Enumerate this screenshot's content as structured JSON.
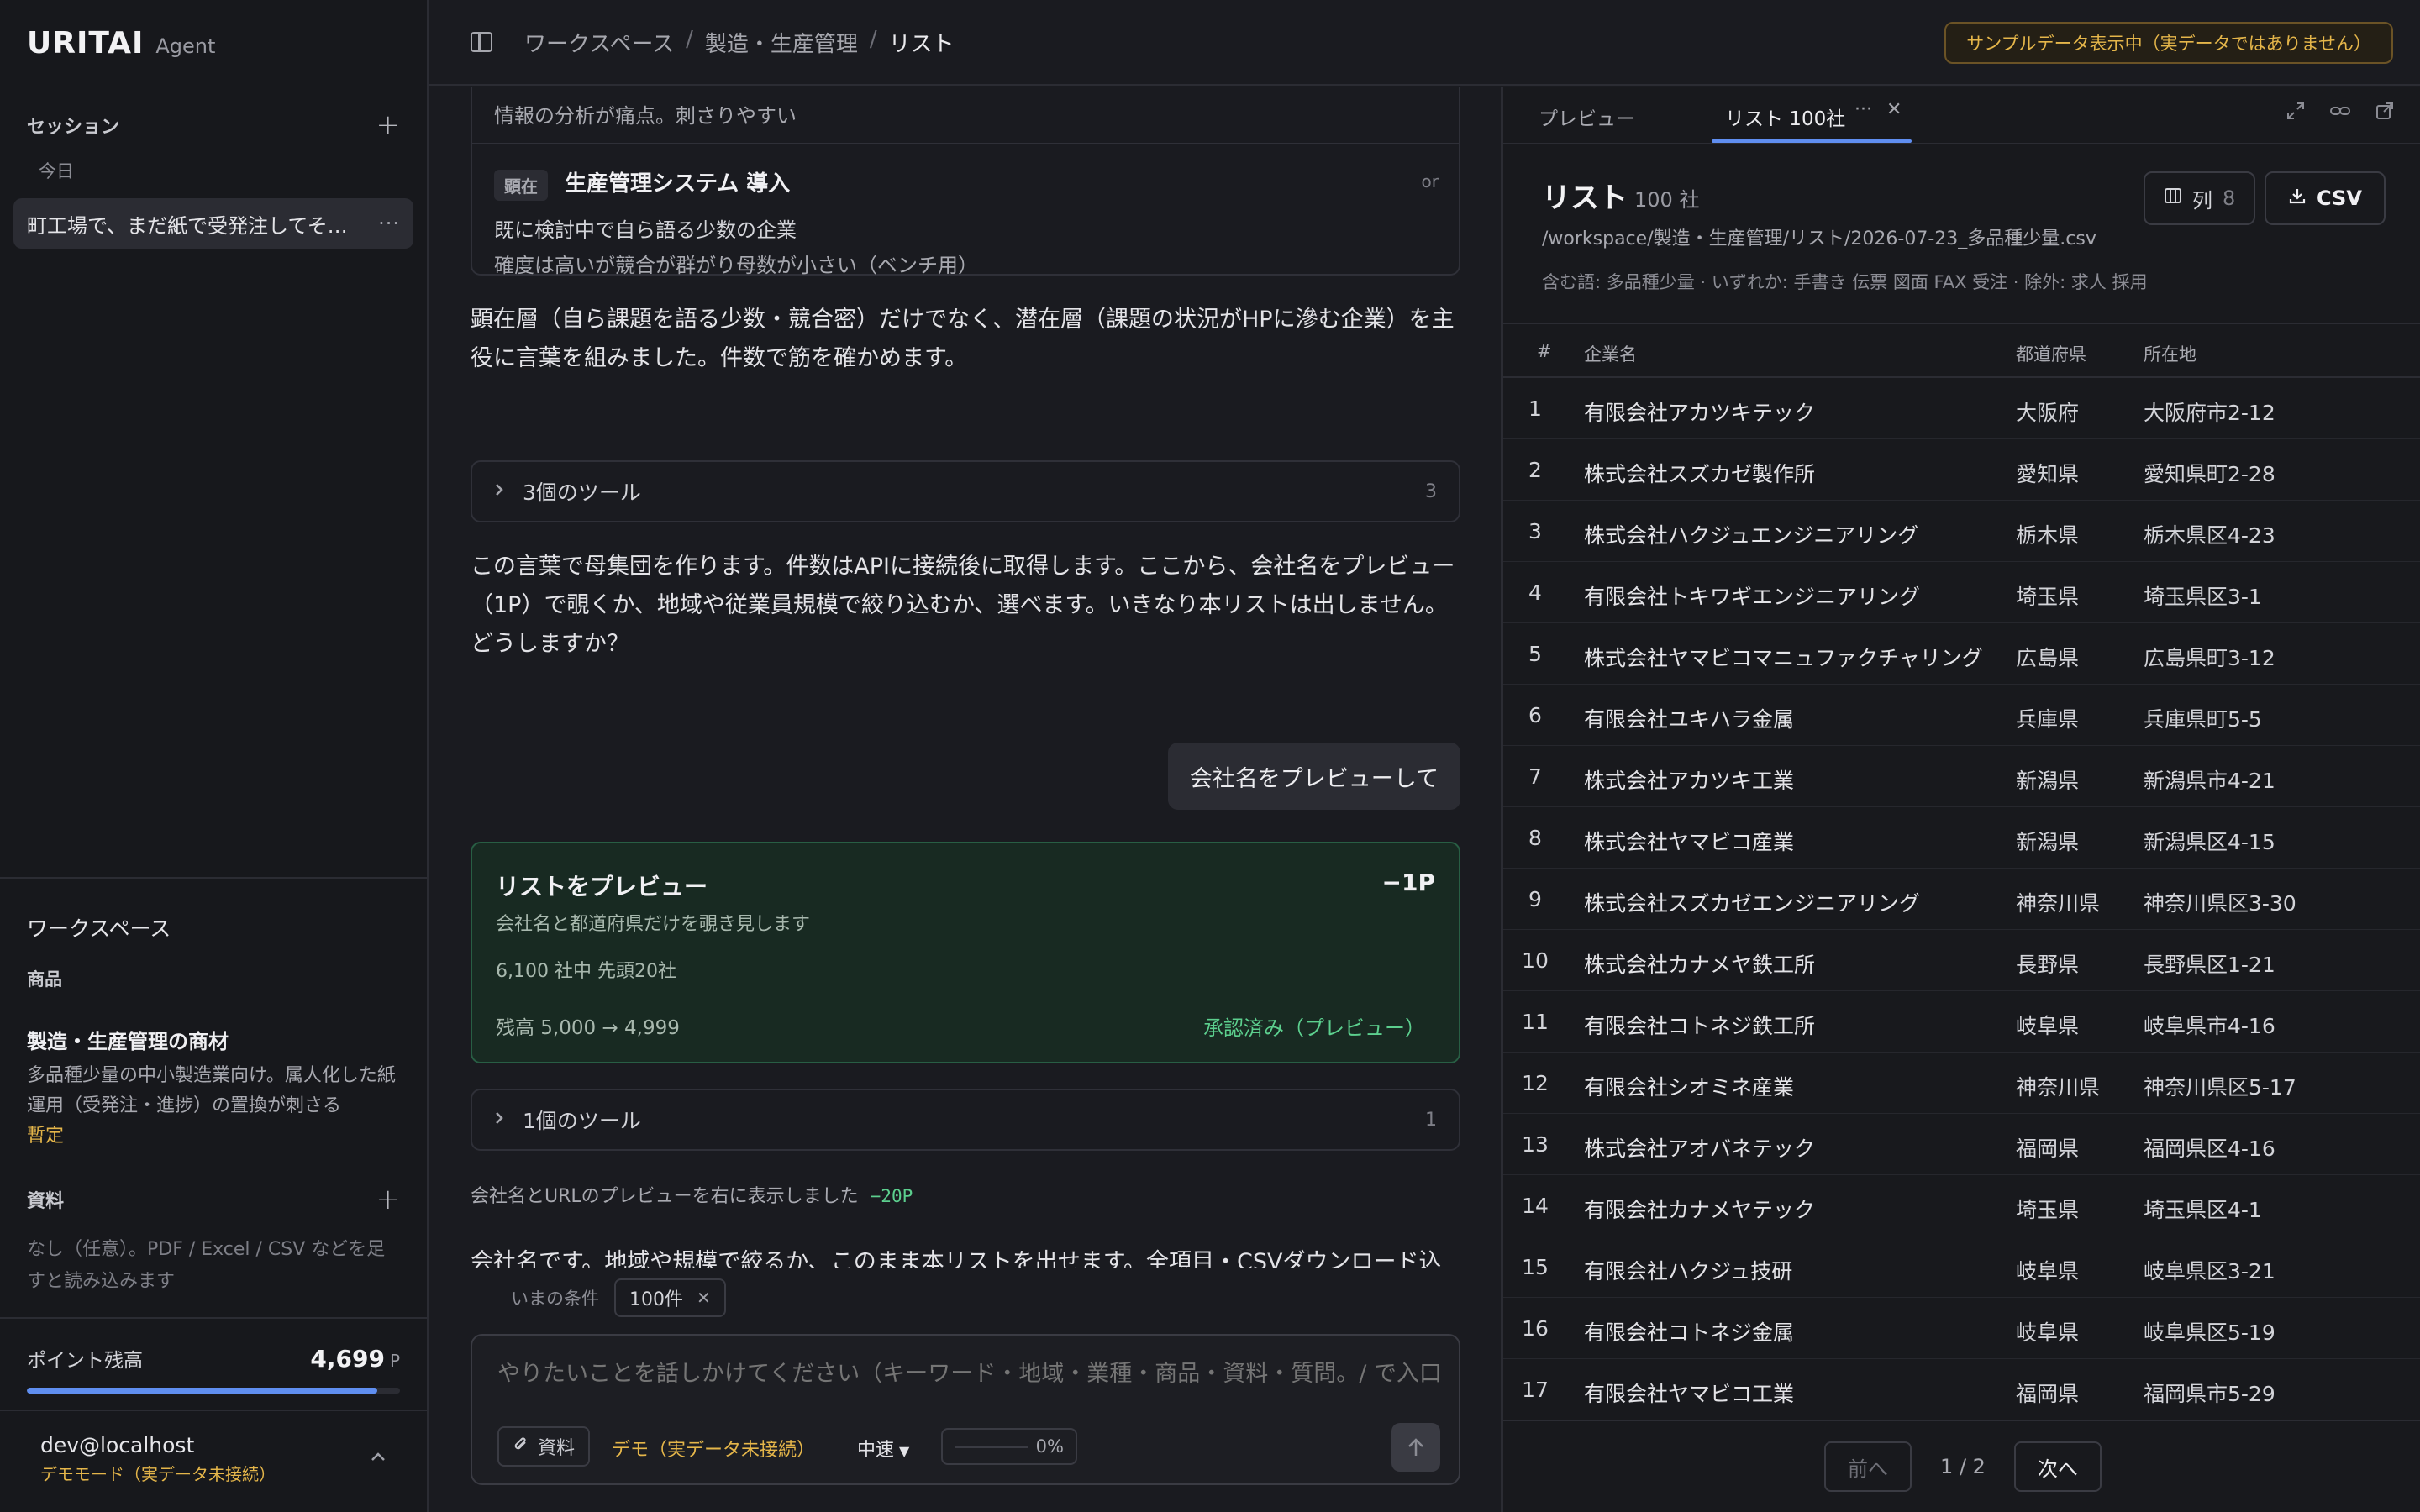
{
  "app": {
    "brand": "URITAI",
    "brand_sub": "Agent"
  },
  "sidebar": {
    "sessions_label": "セッション",
    "today_label": "今日",
    "session_item": "町工場で、まだ紙で受発注してそ…",
    "workspace_title": "ワークスペース",
    "product_label": "商品",
    "product_name": "製造・生産管理の商材",
    "product_desc": "多品種少量の中小製造業向け。属人化した紙運用（受発注・進捗）の置換が刺さる",
    "product_badge": "暫定",
    "materials_label": "資料",
    "materials_desc": "なし（任意）。PDF / Excel / CSV などを足すと読み込みます",
    "points_label": "ポイント残高",
    "points_value": "4,699",
    "points_unit": "P",
    "points_fraction": 0.9398,
    "user_name": "dev@localhost",
    "user_mode": "デモモード（実データ未接続）"
  },
  "topbar": {
    "crumbs": [
      "ワークスペース",
      "製造・生産管理",
      "リスト"
    ],
    "separator": "/",
    "sample_badge": "サンプルデータ表示中（実データではありません）"
  },
  "chat": {
    "card_text1": "情報の分析が痛点。刺さりやすい",
    "card_tag": "顕在",
    "card_title": "生産管理システム 導入",
    "card_or": "or",
    "card_line1": "既に検討中で自ら語る少数の企業",
    "card_line2": "確度は高いが競合が群がり母数が小さい（ベンチ用）",
    "para1": "顕在層（自ら課題を語る少数・競合密）だけでなく、潜在層（課題の状況がHPに滲む企業）を主役に言葉を組みました。件数で筋を確かめます。",
    "tool1_label": "3個のツール",
    "tool1_count": "3",
    "para2": "この言葉で母集団を作ります。件数はAPIに接続後に取得します。ここから、会社名をプレビュー（1P）で覗くか、地域や従業員規模で絞り込むか、選べます。いきなり本リストは出しません。どうしますか？",
    "user_msg": "会社名をプレビューして",
    "preview_title": "リストをプレビュー",
    "preview_cost": "−1P",
    "preview_sub": "会社名と都道府県だけを覗き見します",
    "preview_count": "6,100 社中 先頭20社",
    "preview_balance": "残高 5,000 → 4,999",
    "preview_status": "承認済み（プレビュー）",
    "tool2_label": "1個のツール",
    "tool2_count": "1",
    "preview_note": "会社名とURLのプレビューを右に表示しました",
    "preview_note_cost": "−20P",
    "cut_line": "会社名です。地域や規模で絞るか、このまま本リストを出せます。全項目・CSVダウンロード込",
    "cond_label": "いまの条件",
    "cond_chip": "100件",
    "composer_placeholder": "やりたいことを話しかけてください（キーワード・地域・業種・商品・資料・質問。/ で入口",
    "attach_label": "資料",
    "demo_note": "デモ（実データ未接続）",
    "speed_label": "中速",
    "progress_value": "0%",
    "progress_fraction": 0
  },
  "panel": {
    "tab_preview": "プレビュー",
    "tab_list": "リスト 100社",
    "list_title": "リスト",
    "list_count": "100 社",
    "list_path": "/workspace/製造・生産管理/リスト/2026-07-23_多品種少量.csv",
    "list_filter": "含む語: 多品種少量 · いずれか: 手書き 伝票 図面 FAX 受注 · 除外: 求人 採用",
    "col_label": "列",
    "col_count": "8",
    "csv_label": "CSV",
    "headers": {
      "num": "#",
      "company": "企業名",
      "pref": "都道府県",
      "addr": "所在地"
    },
    "rows": [
      {
        "num": "1",
        "company": "有限会社アカツキテック",
        "pref": "大阪府",
        "addr": "大阪府市2-12"
      },
      {
        "num": "2",
        "company": "株式会社スズカゼ製作所",
        "pref": "愛知県",
        "addr": "愛知県町2-28"
      },
      {
        "num": "3",
        "company": "株式会社ハクジュエンジニアリング",
        "pref": "栃木県",
        "addr": "栃木県区4-23"
      },
      {
        "num": "4",
        "company": "有限会社トキワギエンジニアリング",
        "pref": "埼玉県",
        "addr": "埼玉県区3-1"
      },
      {
        "num": "5",
        "company": "株式会社ヤマビコマニュファクチャリング",
        "pref": "広島県",
        "addr": "広島県町3-12"
      },
      {
        "num": "6",
        "company": "有限会社ユキハラ金属",
        "pref": "兵庫県",
        "addr": "兵庫県町5-5"
      },
      {
        "num": "7",
        "company": "株式会社アカツキ工業",
        "pref": "新潟県",
        "addr": "新潟県市4-21"
      },
      {
        "num": "8",
        "company": "株式会社ヤマビコ産業",
        "pref": "新潟県",
        "addr": "新潟県区4-15"
      },
      {
        "num": "9",
        "company": "株式会社スズカゼエンジニアリング",
        "pref": "神奈川県",
        "addr": "神奈川県区3-30"
      },
      {
        "num": "10",
        "company": "株式会社カナメヤ鉄工所",
        "pref": "長野県",
        "addr": "長野県区1-21"
      },
      {
        "num": "11",
        "company": "有限会社コトネジ鉄工所",
        "pref": "岐阜県",
        "addr": "岐阜県市4-16"
      },
      {
        "num": "12",
        "company": "有限会社シオミネ産業",
        "pref": "神奈川県",
        "addr": "神奈川県区5-17"
      },
      {
        "num": "13",
        "company": "株式会社アオバネテック",
        "pref": "福岡県",
        "addr": "福岡県区4-16"
      },
      {
        "num": "14",
        "company": "有限会社カナメヤテック",
        "pref": "埼玉県",
        "addr": "埼玉県区4-1"
      },
      {
        "num": "15",
        "company": "有限会社ハクジュ技研",
        "pref": "岐阜県",
        "addr": "岐阜県区3-21"
      },
      {
        "num": "16",
        "company": "有限会社コトネジ金属",
        "pref": "岐阜県",
        "addr": "岐阜県区5-19"
      },
      {
        "num": "17",
        "company": "有限会社ヤマビコ工業",
        "pref": "福岡県",
        "addr": "福岡県市5-29"
      }
    ],
    "prev_label": "前へ",
    "page_info": "1 / 2",
    "next_label": "次へ"
  }
}
